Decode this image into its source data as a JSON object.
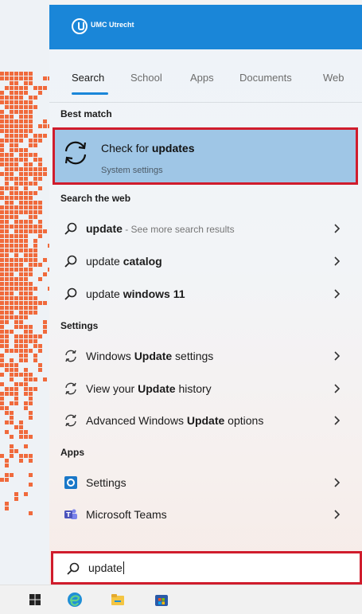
{
  "brand": {
    "name": "UMC Utrecht",
    "color": "#1a86d8"
  },
  "tabs": [
    {
      "label": "Search",
      "active": true
    },
    {
      "label": "School",
      "active": false
    },
    {
      "label": "Apps",
      "active": false
    },
    {
      "label": "Documents",
      "active": false
    },
    {
      "label": "Web",
      "active": false
    }
  ],
  "best_match": {
    "header": "Best match",
    "title_prefix": "Check for ",
    "title_bold": "updates",
    "subtitle": "System settings",
    "icon": "sync-icon"
  },
  "web": {
    "header": "Search the web",
    "items": [
      {
        "text": "update",
        "bold": "",
        "muted": " - See more search results",
        "icon": "search-icon"
      },
      {
        "text": "update ",
        "bold": "catalog",
        "muted": "",
        "icon": "search-icon"
      },
      {
        "text": "update ",
        "bold": "windows 11",
        "muted": "",
        "icon": "search-icon"
      }
    ]
  },
  "settings": {
    "header": "Settings",
    "items": [
      {
        "pre": "Windows ",
        "bold": "Update",
        "post": " settings",
        "icon": "sync-icon"
      },
      {
        "pre": "View your ",
        "bold": "Update",
        "post": " history",
        "icon": "sync-icon"
      },
      {
        "pre": "Advanced Windows ",
        "bold": "Update",
        "post": " options",
        "icon": "sync-icon"
      }
    ]
  },
  "apps": {
    "header": "Apps",
    "items": [
      {
        "label": "Settings",
        "icon": "settings-app-icon"
      },
      {
        "label": "Microsoft Teams",
        "icon": "teams-icon"
      }
    ]
  },
  "search": {
    "value": "update",
    "icon": "search-icon"
  },
  "colors": {
    "highlight": "#9fc6e6",
    "focus_border": "#d01c2c",
    "accent": "#1a86d8",
    "wallpaper_dots": "#f06a3c"
  }
}
